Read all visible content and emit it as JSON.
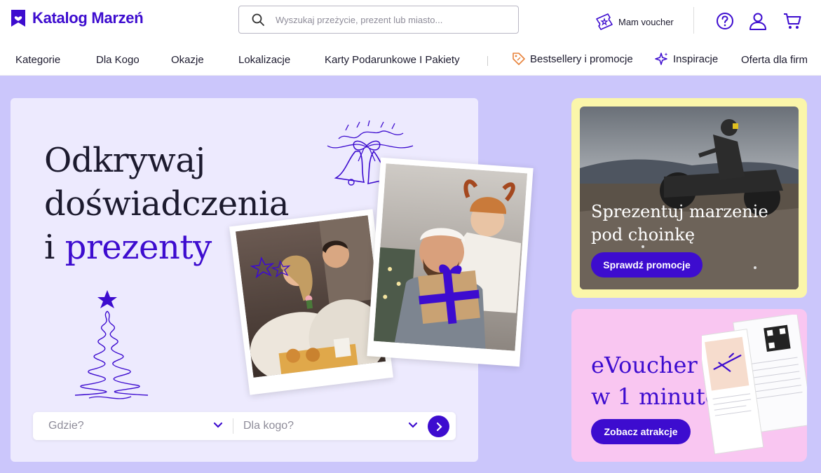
{
  "brand": {
    "name": "Katalog Marzeń",
    "logo_icon": "bookmark-heart-logo",
    "color": "#3d0ccf"
  },
  "search": {
    "placeholder": "Wyszukaj przeżycie, prezent lub miasto..."
  },
  "header": {
    "voucher_label": "Mam voucher",
    "icons": [
      "help-icon",
      "user-icon",
      "cart-icon"
    ]
  },
  "nav": {
    "items": [
      {
        "label": "Kategorie"
      },
      {
        "label": "Dla Kogo"
      },
      {
        "label": "Okazje"
      },
      {
        "label": "Lokalizacje"
      },
      {
        "label": "Karty Podarunkowe I Pakiety"
      },
      {
        "label": "Bestsellery i promocje",
        "icon": "tag-icon"
      },
      {
        "label": "Inspiracje",
        "icon": "sparkle-icon"
      },
      {
        "label": "Oferta dla firm"
      }
    ]
  },
  "hero": {
    "title_line1": "Odkrywaj",
    "title_line2": "doświadczenia",
    "title_line3_prefix": "i",
    "title_line3_accent": "prezenty",
    "filters": {
      "where_placeholder": "Gdzie?",
      "for_whom_placeholder": "Dla kogo?"
    }
  },
  "promo_christmas": {
    "title_line1": "Sprezentuj marzenie",
    "title_line2": "pod choinkę",
    "button": "Sprawdź promocje"
  },
  "promo_evoucher": {
    "title_line1": "eVoucher",
    "title_line2": "w 1 minutę",
    "button": "Zobacz atrakcje"
  },
  "colors": {
    "accent": "#3d0ccf",
    "page_bg": "#cbc6fb",
    "hero_bg": "#edeafe",
    "promo_yellow": "#fbf6aa",
    "promo_pink": "#f9c6f1"
  }
}
